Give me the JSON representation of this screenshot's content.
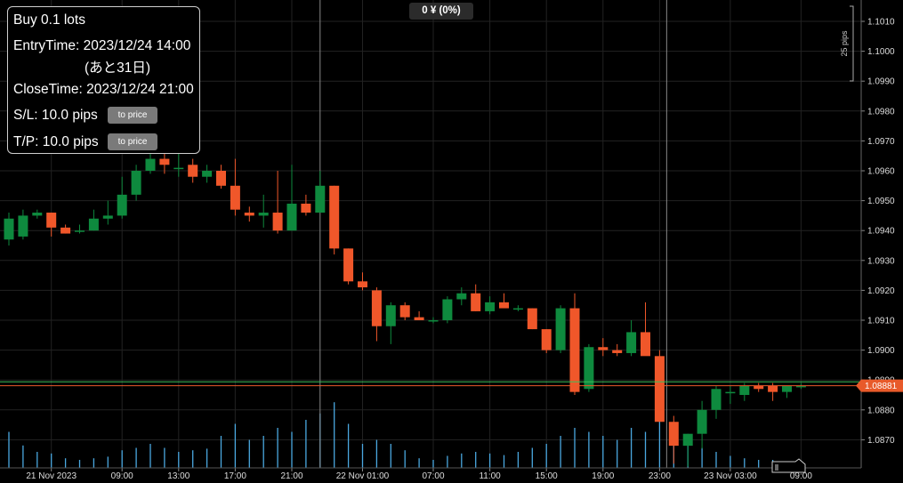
{
  "trade_panel": {
    "title": "Buy 0.1 lots",
    "entry_time": "EntryTime: 2023/12/24 14:00",
    "entry_remaining": "(あと31日)",
    "close_time": "CloseTime: 2023/12/24 21:00",
    "stop_loss": "S/L: 10.0 pips",
    "take_profit": "T/P: 10.0 pips",
    "to_price_label": "to price"
  },
  "pnl_badge": "0 ¥ (0%)",
  "colors": {
    "bull": "#0e8a3e",
    "bear": "#f0572a",
    "volume": "#4aa8e0",
    "current_price_line": "#e85a2a",
    "entry_line": "#3cbf5a"
  },
  "chart_data": {
    "type": "candlestick",
    "instrument_note": "",
    "current_price": "1.08881",
    "entry_line_price": 1.08888,
    "range_marker_label": "25 pips",
    "y_ticks": [
      "1.1010",
      "1.1000",
      "1.0990",
      "1.0980",
      "1.0970",
      "1.0960",
      "1.0950",
      "1.0940",
      "1.0930",
      "1.0920",
      "1.0910",
      "1.0900",
      "1.0890",
      "1.0880",
      "1.0870"
    ],
    "x_ticks": [
      {
        "label": "21 Nov 2023",
        "i": 3
      },
      {
        "label": "09:00",
        "i": 8
      },
      {
        "label": "13:00",
        "i": 12
      },
      {
        "label": "17:00",
        "i": 16
      },
      {
        "label": "21:00",
        "i": 20
      },
      {
        "label": "22 Nov 01:00",
        "i": 25
      },
      {
        "label": "07:00",
        "i": 30
      },
      {
        "label": "11:00",
        "i": 34
      },
      {
        "label": "15:00",
        "i": 38
      },
      {
        "label": "19:00",
        "i": 42
      },
      {
        "label": "23:00",
        "i": 46
      },
      {
        "label": "23 Nov 03:00",
        "i": 51
      },
      {
        "label": "09:00",
        "i": 56
      }
    ],
    "entry_time_index": 22,
    "close_time_index": 46.5,
    "candles": [
      {
        "o": 1.0937,
        "h": 1.0946,
        "l": 1.0935,
        "c": 1.0944,
        "v": 0.45
      },
      {
        "o": 1.0938,
        "h": 1.0947,
        "l": 1.0937,
        "c": 1.0945,
        "v": 0.28
      },
      {
        "o": 1.0945,
        "h": 1.0947,
        "l": 1.0944,
        "c": 1.0946,
        "v": 0.2
      },
      {
        "o": 1.0946,
        "h": 1.0946,
        "l": 1.0938,
        "c": 1.0941,
        "v": 0.18
      },
      {
        "o": 1.0941,
        "h": 1.0942,
        "l": 1.0939,
        "c": 1.0939,
        "v": 0.12
      },
      {
        "o": 1.094,
        "h": 1.0942,
        "l": 1.0939,
        "c": 1.094,
        "v": 0.1
      },
      {
        "o": 1.094,
        "h": 1.0947,
        "l": 1.094,
        "c": 1.0944,
        "v": 0.12
      },
      {
        "o": 1.0944,
        "h": 1.095,
        "l": 1.0942,
        "c": 1.0945,
        "v": 0.14
      },
      {
        "o": 1.0945,
        "h": 1.0958,
        "l": 1.0944,
        "c": 1.0952,
        "v": 0.22
      },
      {
        "o": 1.0952,
        "h": 1.0962,
        "l": 1.095,
        "c": 1.096,
        "v": 0.25
      },
      {
        "o": 1.096,
        "h": 1.0966,
        "l": 1.0959,
        "c": 1.0964,
        "v": 0.3
      },
      {
        "o": 1.0964,
        "h": 1.0966,
        "l": 1.0959,
        "c": 1.0962,
        "v": 0.25
      },
      {
        "o": 1.0961,
        "h": 1.0966,
        "l": 1.0958,
        "c": 1.0961,
        "v": 0.2
      },
      {
        "o": 1.0962,
        "h": 1.0964,
        "l": 1.0956,
        "c": 1.0958,
        "v": 0.22
      },
      {
        "o": 1.0958,
        "h": 1.0962,
        "l": 1.0956,
        "c": 1.096,
        "v": 0.24
      },
      {
        "o": 1.096,
        "h": 1.0962,
        "l": 1.0954,
        "c": 1.0955,
        "v": 0.4
      },
      {
        "o": 1.0955,
        "h": 1.0964,
        "l": 1.0945,
        "c": 1.0947,
        "v": 0.55
      },
      {
        "o": 1.0946,
        "h": 1.0948,
        "l": 1.0943,
        "c": 1.0945,
        "v": 0.35
      },
      {
        "o": 1.0945,
        "h": 1.0952,
        "l": 1.0941,
        "c": 1.0946,
        "v": 0.4
      },
      {
        "o": 1.0946,
        "h": 1.096,
        "l": 1.0939,
        "c": 1.094,
        "v": 0.5
      },
      {
        "o": 1.094,
        "h": 1.0962,
        "l": 1.094,
        "c": 1.0949,
        "v": 0.45
      },
      {
        "o": 1.0949,
        "h": 1.0952,
        "l": 1.0945,
        "c": 1.0946,
        "v": 0.6
      },
      {
        "o": 1.0946,
        "h": 1.096,
        "l": 1.0946,
        "c": 1.0955,
        "v": 0.68
      },
      {
        "o": 1.0955,
        "h": 1.0955,
        "l": 1.0932,
        "c": 1.0934,
        "v": 0.82
      },
      {
        "o": 1.0934,
        "h": 1.0934,
        "l": 1.0922,
        "c": 1.0923,
        "v": 0.55
      },
      {
        "o": 1.0923,
        "h": 1.0926,
        "l": 1.092,
        "c": 1.0921,
        "v": 0.3
      },
      {
        "o": 1.092,
        "h": 1.0921,
        "l": 1.0903,
        "c": 1.0908,
        "v": 0.35
      },
      {
        "o": 1.0908,
        "h": 1.0916,
        "l": 1.0902,
        "c": 1.0915,
        "v": 0.3
      },
      {
        "o": 1.0915,
        "h": 1.0916,
        "l": 1.091,
        "c": 1.0911,
        "v": 0.22
      },
      {
        "o": 1.0911,
        "h": 1.0913,
        "l": 1.091,
        "c": 1.091,
        "v": 0.12
      },
      {
        "o": 1.091,
        "h": 1.0911,
        "l": 1.0909,
        "c": 1.091,
        "v": 0.1
      },
      {
        "o": 1.091,
        "h": 1.0918,
        "l": 1.0909,
        "c": 1.0917,
        "v": 0.15
      },
      {
        "o": 1.0917,
        "h": 1.0921,
        "l": 1.0915,
        "c": 1.0919,
        "v": 0.18
      },
      {
        "o": 1.0919,
        "h": 1.0922,
        "l": 1.0913,
        "c": 1.0913,
        "v": 0.2
      },
      {
        "o": 1.0913,
        "h": 1.0918,
        "l": 1.0912,
        "c": 1.0916,
        "v": 0.18
      },
      {
        "o": 1.0916,
        "h": 1.0919,
        "l": 1.0914,
        "c": 1.0914,
        "v": 0.16
      },
      {
        "o": 1.0914,
        "h": 1.0915,
        "l": 1.0913,
        "c": 1.0914,
        "v": 0.2
      },
      {
        "o": 1.0914,
        "h": 1.0914,
        "l": 1.0907,
        "c": 1.0907,
        "v": 0.25
      },
      {
        "o": 1.0907,
        "h": 1.0907,
        "l": 1.0899,
        "c": 1.09,
        "v": 0.3
      },
      {
        "o": 1.09,
        "h": 1.0915,
        "l": 1.0899,
        "c": 1.0914,
        "v": 0.4
      },
      {
        "o": 1.0914,
        "h": 1.0919,
        "l": 1.0885,
        "c": 1.0886,
        "v": 0.5
      },
      {
        "o": 1.0887,
        "h": 1.0902,
        "l": 1.0886,
        "c": 1.0901,
        "v": 0.45
      },
      {
        "o": 1.0901,
        "h": 1.0904,
        "l": 1.0898,
        "c": 1.09,
        "v": 0.4
      },
      {
        "o": 1.09,
        "h": 1.0902,
        "l": 1.0898,
        "c": 1.0899,
        "v": 0.35
      },
      {
        "o": 1.0899,
        "h": 1.091,
        "l": 1.0898,
        "c": 1.0906,
        "v": 0.5
      },
      {
        "o": 1.0906,
        "h": 1.0916,
        "l": 1.0899,
        "c": 1.0898,
        "v": 0.45
      },
      {
        "o": 1.0898,
        "h": 1.09,
        "l": 1.0876,
        "c": 1.0876,
        "v": 0.7
      },
      {
        "o": 1.0876,
        "h": 1.0878,
        "l": 1.0862,
        "c": 1.0868,
        "v": 0.55
      },
      {
        "o": 1.0868,
        "h": 1.0872,
        "l": 1.0861,
        "c": 1.0872,
        "v": 0.35
      },
      {
        "o": 1.0872,
        "h": 1.0883,
        "l": 1.0867,
        "c": 1.088,
        "v": 0.25
      },
      {
        "o": 1.088,
        "h": 1.0888,
        "l": 1.0877,
        "c": 1.0887,
        "v": 0.2
      },
      {
        "o": 1.0886,
        "h": 1.0888,
        "l": 1.0882,
        "c": 1.0886,
        "v": 0.15
      },
      {
        "o": 1.0885,
        "h": 1.0889,
        "l": 1.0883,
        "c": 1.0888,
        "v": 0.12
      },
      {
        "o": 1.0888,
        "h": 1.0889,
        "l": 1.0886,
        "c": 1.0887,
        "v": 0.1
      },
      {
        "o": 1.0888,
        "h": 1.0889,
        "l": 1.0883,
        "c": 1.0886,
        "v": 0.1
      },
      {
        "o": 1.0886,
        "h": 1.0888,
        "l": 1.0884,
        "c": 1.0888,
        "v": 0.06
      },
      {
        "o": 1.0888,
        "h": 1.0889,
        "l": 1.0887,
        "c": 1.0888,
        "v": 0.04
      }
    ]
  }
}
